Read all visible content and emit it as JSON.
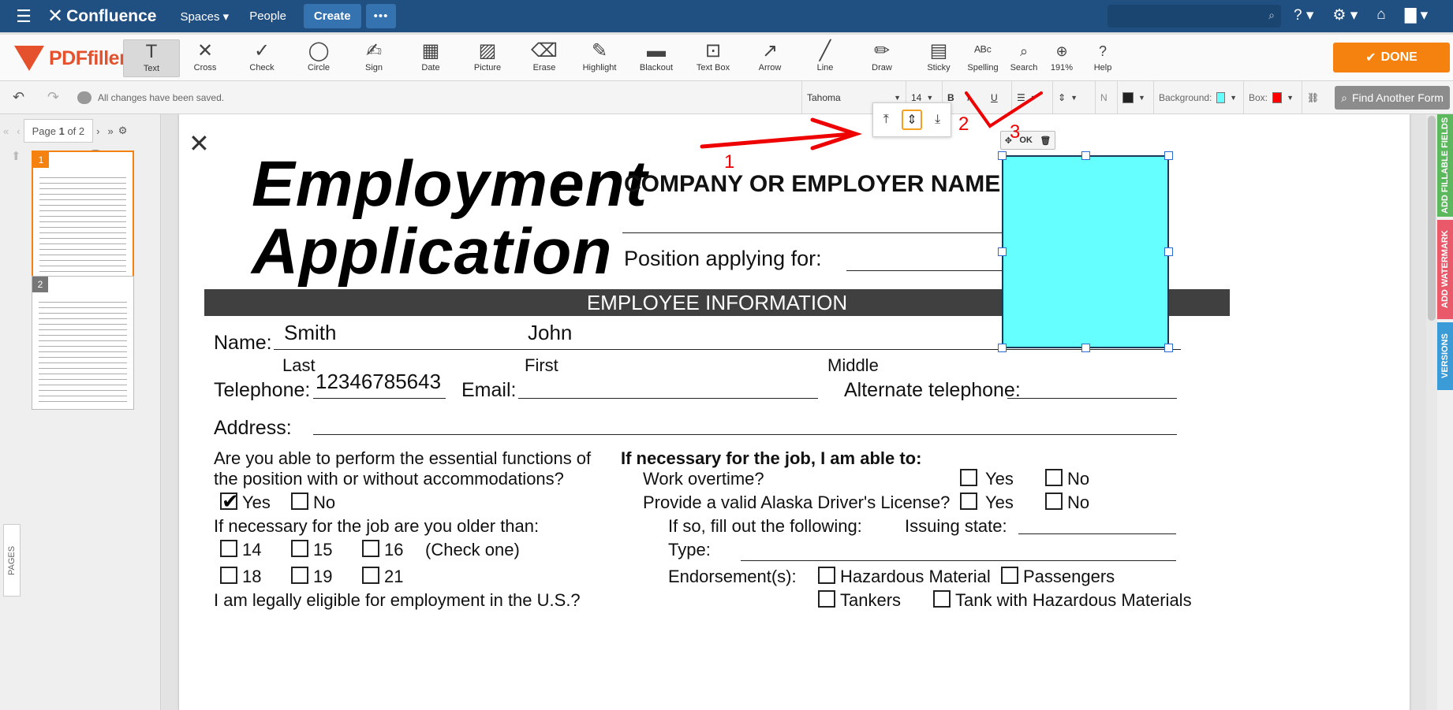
{
  "confluence": {
    "logo": "Confluence",
    "nav": {
      "spaces": "Spaces",
      "people": "People",
      "create": "Create",
      "more": "•••"
    }
  },
  "toolbar": {
    "brand": "PDFfiller",
    "tools": [
      {
        "label": "Text",
        "icon": "text-icon",
        "glyph": "T"
      },
      {
        "label": "Cross",
        "icon": "cross-icon",
        "glyph": "✕"
      },
      {
        "label": "Check",
        "icon": "check-icon",
        "glyph": "✓"
      },
      {
        "label": "Circle",
        "icon": "circle-icon",
        "glyph": "◯"
      },
      {
        "label": "Sign",
        "icon": "sign-icon",
        "glyph": "✍"
      },
      {
        "label": "Date",
        "icon": "date-icon",
        "glyph": "▦"
      },
      {
        "label": "Picture",
        "icon": "picture-icon",
        "glyph": "▨"
      },
      {
        "label": "Erase",
        "icon": "erase-icon",
        "glyph": "⌫"
      },
      {
        "label": "Highlight",
        "icon": "highlight-icon",
        "glyph": "✎"
      },
      {
        "label": "Blackout",
        "icon": "blackout-icon",
        "glyph": "▬"
      },
      {
        "label": "Text Box",
        "icon": "textbox-icon",
        "glyph": "⊡"
      },
      {
        "label": "Arrow",
        "icon": "arrow-icon",
        "glyph": "↗"
      },
      {
        "label": "Line",
        "icon": "line-icon",
        "glyph": "╱"
      },
      {
        "label": "Draw",
        "icon": "draw-icon",
        "glyph": "✏"
      },
      {
        "label": "Sticky",
        "icon": "sticky-icon",
        "glyph": "▤"
      },
      {
        "label": "Spelling",
        "icon": "spelling-icon",
        "glyph": "ᴬᴮᶜ"
      },
      {
        "label": "Search",
        "icon": "search-icon",
        "glyph": "⌕"
      },
      {
        "label": "191%",
        "icon": "zoom-icon",
        "glyph": "⊕"
      },
      {
        "label": "Help",
        "icon": "help-icon",
        "glyph": "?"
      }
    ],
    "done": "DONE"
  },
  "subbar": {
    "saved": "All changes have been saved.",
    "font": "Tahoma",
    "size": "14",
    "bold": "B",
    "italic": "I",
    "underline": "U",
    "normal": "N",
    "background_label": "Background:",
    "box_label": "Box:",
    "text_color": "#222222",
    "background_color": "#66ffff",
    "box_color": "#ff0000",
    "find_form": "Find Another Form"
  },
  "sidebar": {
    "page_prefix": "Page",
    "page_current": "1",
    "page_of": "of 2",
    "thumbnails": [
      "1",
      "2"
    ],
    "pages_tab": "PAGES"
  },
  "document": {
    "title_line1": "Employment",
    "title_line2": "Application",
    "company_label": "COMPANY OR EMPLOYER NAME:",
    "position_label": "Position applying for:",
    "section": "EMPLOYEE INFORMATION",
    "name_label": "Name:",
    "name_last_value": "Smith",
    "name_first_value": "John",
    "last": "Last",
    "first": "First",
    "middle": "Middle",
    "telephone_label": "Telephone:",
    "telephone_value": "12346785643",
    "email_label": "Email:",
    "alt_phone_label": "Alternate telephone:",
    "address_label": "Address:",
    "essential_q1": "Are you able to perform the essential functions of",
    "essential_q2": "the position with or without accommodations?",
    "yes": "Yes",
    "no": "No",
    "older_q": "If necessary for the job are you older than:",
    "ages": [
      "14",
      "15",
      "16",
      "18",
      "19",
      "21"
    ],
    "check_one": "(Check one)",
    "legal_q": "I am legally eligible for employment in the U.S.?",
    "able_title": "If necessary for the job, I am able to:",
    "overtime": "Work overtime?",
    "license": "Provide a valid Alaska Driver's License?",
    "fill_following": "If so, fill out the following:",
    "issuing_state": "Issuing state:",
    "type": "Type:",
    "endorsements": "Endorsement(s):",
    "hazardous": "Hazardous Material",
    "passengers": "Passengers",
    "tankers": "Tankers",
    "tank_hazardous": "Tank with Hazardous Materials"
  },
  "minitoolbar": {
    "ok": "OK"
  },
  "annotations": {
    "a1": "1",
    "a2": "2",
    "a3": "3"
  },
  "right_tabs": {
    "fillable": "ADD FILLABLE FIELDS",
    "watermark": "ADD WATERMARK",
    "versions": "VERSIONS"
  }
}
